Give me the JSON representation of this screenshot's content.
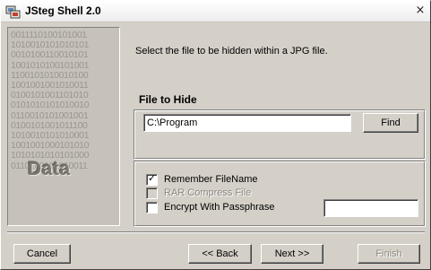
{
  "window": {
    "title": "JSteg Shell 2.0",
    "close_glyph": "×"
  },
  "side_panel": {
    "binary_lines": [
      "0011110100101001",
      "1010010101010101",
      "0010100110010101",
      "1001010100101001",
      "1100101010010100",
      "1001001001010011",
      "0100101001101010",
      "0101010101010010",
      "0110010101001001",
      "0100101001011100",
      "1010010101010001",
      "1001001000101010",
      "1010101010101000",
      "0110100101010011"
    ],
    "logo_text": "Data"
  },
  "instruction": "Select the file to be hidden within a JPG file.",
  "file_group": {
    "title": "File to Hide",
    "path_value": "C:\\Program",
    "find_label": "Find"
  },
  "options": {
    "remember": {
      "label": "Remember FileName",
      "checked": true,
      "enabled": true
    },
    "rar": {
      "label": "RAR Compress File",
      "checked": false,
      "enabled": false
    },
    "encrypt": {
      "label": "Encrypt With Passphrase",
      "checked": false,
      "enabled": true
    },
    "passphrase_value": ""
  },
  "buttons": {
    "cancel": "Cancel",
    "back": "<< Back",
    "next": "Next >>",
    "finish": "Finish"
  },
  "icons": {
    "app_icon": "jsteg-app-icon",
    "close": "close-icon",
    "check": "checkmark-icon"
  },
  "colors": {
    "window_bg": "#d4d0c8",
    "disabled_text": "#8c8880",
    "binary_text": "#9a9690"
  }
}
